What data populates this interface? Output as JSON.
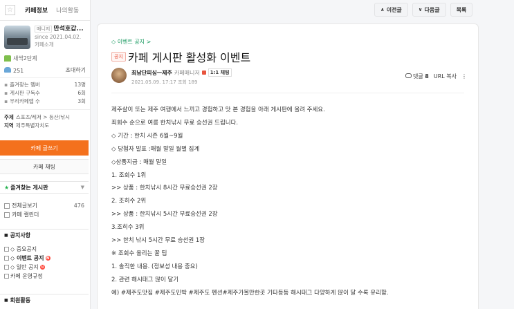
{
  "sidebar": {
    "tabs": {
      "cafe_info": "카페정보",
      "my_activity": "나의활동"
    },
    "profile": {
      "manager_badge": "매니저",
      "name": "만석호갑...",
      "since": "since 2021.04.02.",
      "intro": "카페소개"
    },
    "level": "새싹2단계",
    "members": {
      "count": "251",
      "invite": "초대하기"
    },
    "stats": [
      {
        "label": "즐겨찾는 멤버",
        "value": "13명"
      },
      {
        "label": "게시판 구독수",
        "value": "6회"
      },
      {
        "label": "우리카페앱 수",
        "value": "3회"
      }
    ],
    "topic": {
      "label": "주제",
      "value": "스포츠/레저 > 등산/낚시"
    },
    "region": {
      "label": "지역",
      "value": "제주특별자치도"
    },
    "write_button": "카페 글쓰기",
    "chat_button": "카페 채팅",
    "favorites_header": "즐겨찾는 게시판",
    "boards": [
      {
        "label": "전체글보기",
        "count": "476"
      },
      {
        "label": "카페 캘린더",
        "count": ""
      }
    ],
    "notice_header": "공지사항",
    "notices": [
      {
        "label": "◇ 중요공지",
        "new": false
      },
      {
        "label": "◇ 이벤트 공지",
        "new": true
      },
      {
        "label": "◇ 일반 공지",
        "new": true
      },
      {
        "label": "카페 운영규정",
        "new": false
      }
    ],
    "member_header": "회원활동",
    "new_badge": "N"
  },
  "nav": {
    "prev": "이전글",
    "next": "다음글",
    "list": "목록"
  },
  "article": {
    "breadcrumb": "◇ 이벤트 공지 >",
    "badge": "공지",
    "title": "카페 게시판 활성화 이벤트",
    "author": "최남단피싱ㅡ제주",
    "role": "카페매니저",
    "chat_tag": "1:1 채팅",
    "date": "2021.05.09. 17:17",
    "views_label": "조회 189",
    "comments_label": "댓글",
    "comments_count": "8",
    "url_copy": "URL 복사",
    "more": "⋮",
    "lines": [
      "제주살이 또는 제주 여행에서 느끼고 경험하고 맛 본 경험을 아래 게시판에 올려 주세요.",
      "죄회수 순으로 여름 한치낚시 무료 승선권 드립니다.",
      "◇ 기간 : 한치 시즌 6월~9월",
      "◇ 당첨자 발표 :매월 말일 월별 집계",
      "◇상품지급 : 매월 말일",
      "1. 조회수 1위",
      ">> 상품 : 한치낚시  8시간 무료승선권 2장",
      "2. 조히수 2위",
      ">> 상품 : 한치낚시 5시간 무료승선권 2장",
      "3.조히수 3위",
      ">> 한치 낚시 5시간 무료 승선권 1장",
      "※ 조회수 올리는 꿀 팁",
      "1. 솔직한 내용. (정보성 내용 중요)",
      "2. 관련 해시태그 많이 달기",
      "예) #제주도맛집 #제주도민박 #제주도 펜션#제주가볼만한곳 기타등등 해시태그 다양하게 많이 달 수록 유리함."
    ]
  },
  "colors": {
    "accent": "#f4711d",
    "green": "#1a9a61",
    "notice_red": "#e8543e"
  }
}
